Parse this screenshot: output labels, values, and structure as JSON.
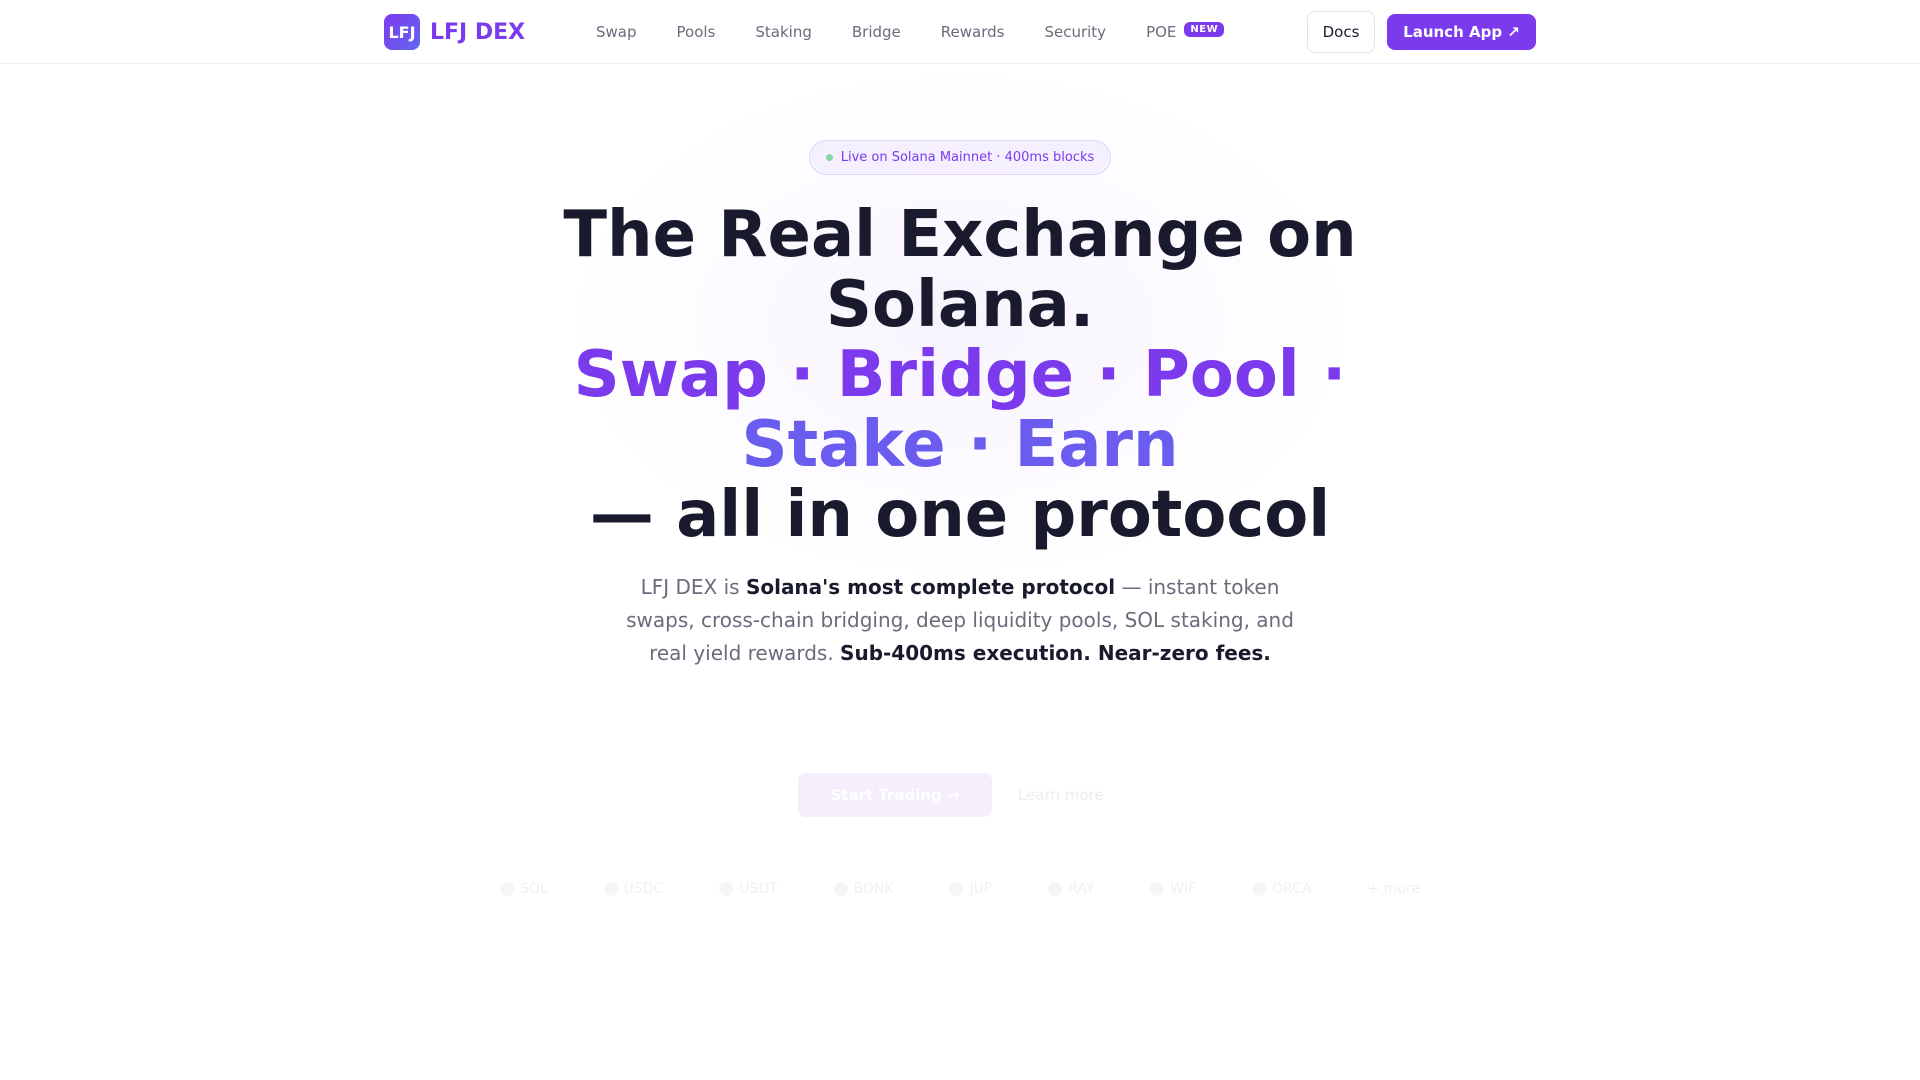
{
  "brand": {
    "mark": "LFJ",
    "name": "LFJ DEX",
    "accent": "#7c3aed"
  },
  "nav": {
    "links": [
      {
        "label": "Swap"
      },
      {
        "label": "Pools"
      },
      {
        "label": "Staking"
      },
      {
        "label": "Bridge"
      },
      {
        "label": "Rewards"
      },
      {
        "label": "Security"
      },
      {
        "label": "POE",
        "badge": "NEW"
      }
    ],
    "docs_label": "Docs",
    "launch_label": "Launch App ↗"
  },
  "hero": {
    "pill_text": "Live on Solana Mainnet · 400ms blocks",
    "headline_line1": "The Real Exchange on",
    "headline_line2": "Solana.",
    "headline_accent1": "Swap · Bridge · Pool ·",
    "headline_accent2": "Stake · Earn",
    "headline_line3": "— all in one protocol",
    "sub_p1": "LFJ DEX is ",
    "sub_b1": "Solana's most complete protocol",
    "sub_p2": " — instant token swaps, cross-chain bridging, deep liquidity pools, SOL staking, and real yield rewards. ",
    "sub_b2": "Sub-400ms execution. Near-zero fees."
  },
  "cta": {
    "primary": "Start Trading →",
    "secondary": "Learn more"
  },
  "tokens": [
    "SOL",
    "USDC",
    "USDT",
    "BONK",
    "JUP",
    "RAY",
    "WIF",
    "ORCA",
    "+ more"
  ]
}
